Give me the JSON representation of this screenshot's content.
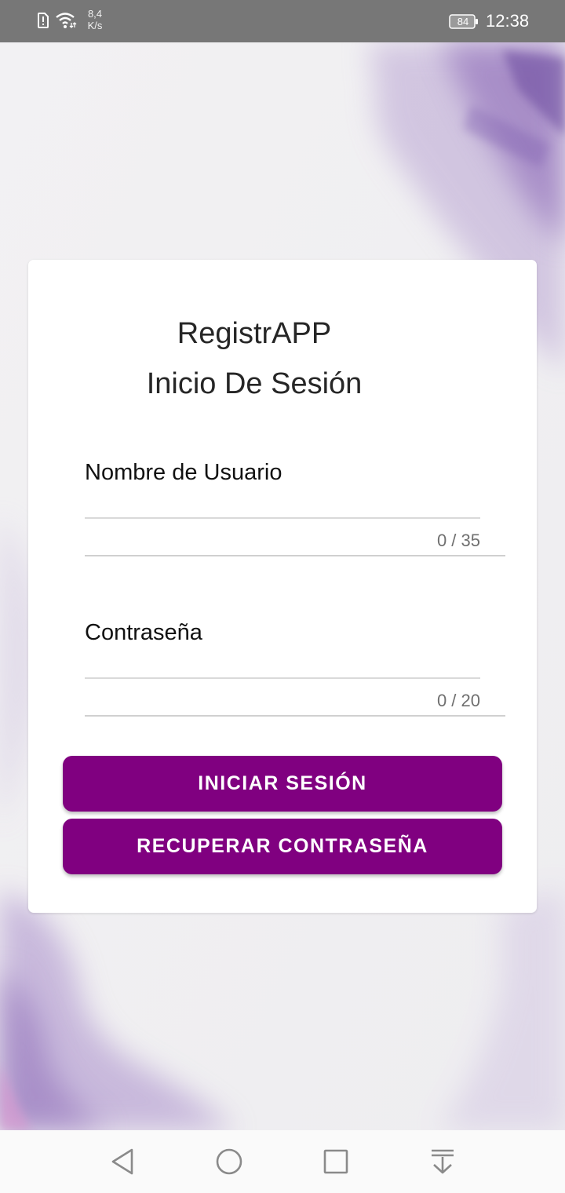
{
  "status_bar": {
    "net_speed_value": "8,4",
    "net_speed_unit": "K/s",
    "battery_level": "84",
    "time": "12:38",
    "icons": [
      "sim-alert-icon",
      "wifi-icon",
      "battery-icon"
    ]
  },
  "login": {
    "app_title": "RegistrAPP",
    "subtitle": "Inicio De Sesión",
    "username": {
      "label": "Nombre de Usuario",
      "value": "",
      "counter": "0 / 35"
    },
    "password": {
      "label": "Contraseña",
      "value": "",
      "counter": "0 / 20"
    },
    "login_button": "INICIAR SESIÓN",
    "recover_button": "RECUPERAR CONTRASEÑA"
  },
  "nav_bar": {
    "icons": [
      "back-icon",
      "home-icon",
      "recents-icon",
      "notification-pull-icon"
    ]
  },
  "colors": {
    "accent": "#800080",
    "status_bar": "#777777",
    "background": "#f1f0f2",
    "card": "#ffffff"
  }
}
